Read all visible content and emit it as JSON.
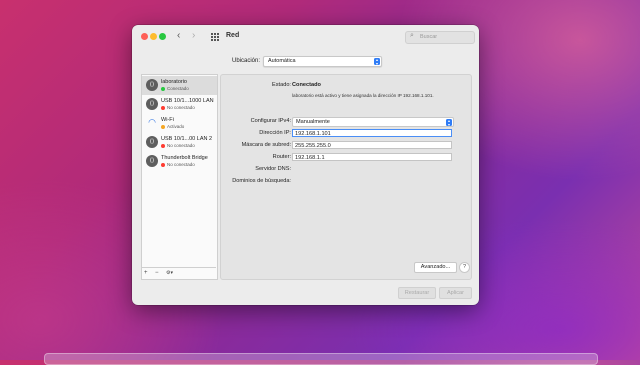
{
  "window": {
    "title": "Red",
    "search_placeholder": "Buscar",
    "nav_back_icon": "chevron-left-icon",
    "nav_forward_icon": "chevron-right-icon"
  },
  "location": {
    "label": "Ubicación:",
    "value": "Automática"
  },
  "sidebar": {
    "items": [
      {
        "name": "laboratorio",
        "status": "Conectado",
        "status_color": "#28c840",
        "icon": "ethernet-icon",
        "selected": true
      },
      {
        "name": "USB 10/1...1000 LAN",
        "status": "No conectado",
        "status_color": "#fe3b30",
        "icon": "ethernet-icon",
        "selected": false
      },
      {
        "name": "Wi-Fi",
        "status": "Activado",
        "status_color": "#f5a623",
        "icon": "wifi-icon",
        "selected": false
      },
      {
        "name": "USB 10/1...00 LAN 2",
        "status": "No conectado",
        "status_color": "#fe3b30",
        "icon": "ethernet-icon",
        "selected": false
      },
      {
        "name": "Thunderbolt Bridge",
        "status": "No conectado",
        "status_color": "#fe3b30",
        "icon": "ethernet-icon",
        "selected": false
      }
    ],
    "footer": {
      "add": "+",
      "remove": "−",
      "actions": "⚙▾"
    }
  },
  "detail": {
    "status_label": "Estado:",
    "status_value": "Conectado",
    "status_description": "laboratorio está activo y tiene asignada la dirección IP 192.168.1.101.",
    "configure_label": "Configurar IPv4:",
    "configure_value": "Manualmente",
    "ip_label": "Dirección IP:",
    "ip_value": "192.168.1.101",
    "mask_label": "Máscara de subred:",
    "mask_value": "255.255.255.0",
    "router_label": "Router:",
    "router_value": "192.168.1.1",
    "dns_label": "Servidor DNS:",
    "search_domains_label": "Dominios de búsqueda:",
    "advanced_button": "Avanzado...",
    "help_button": "?"
  },
  "buttons": {
    "revert": "Restaurar",
    "apply": "Aplicar"
  },
  "colors": {
    "accent": "#2f7cf6",
    "connected": "#28c840",
    "disconnected": "#fe3b30",
    "active": "#f5a623"
  }
}
